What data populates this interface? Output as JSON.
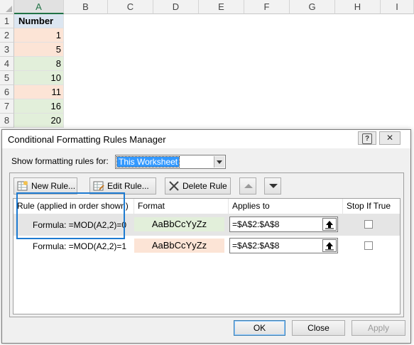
{
  "sheet": {
    "columns": [
      "A",
      "B",
      "C",
      "D",
      "E",
      "F",
      "G",
      "H",
      "I"
    ],
    "rows": [
      "1",
      "2",
      "3",
      "4",
      "5",
      "6",
      "7",
      "8"
    ],
    "header_cell": "Number",
    "values": [
      "1",
      "5",
      "8",
      "10",
      "11",
      "16",
      "20"
    ],
    "even_fill": "#e2efda",
    "odd_fill": "#fce4d6"
  },
  "dialog": {
    "title": "Conditional Formatting Rules Manager",
    "help_label": "?",
    "close_label": "✕",
    "show_label": "Show formatting rules for:",
    "scope_value": "This Worksheet",
    "buttons": {
      "new_rule": "New Rule...",
      "edit_rule": "Edit Rule...",
      "delete_rule": "Delete Rule"
    },
    "columns": {
      "rule": "Rule (applied in order shown)",
      "format": "Format",
      "applies_to": "Applies to",
      "stop_if_true": "Stop If True"
    },
    "rules": [
      {
        "rule": "Formula: =MOD(A2,2)=0",
        "format_preview": "AaBbCcYyZz",
        "fill": "#e2efda",
        "applies_to": "=$A$2:$A$8",
        "stop_if_true": false
      },
      {
        "rule": "Formula: =MOD(A2,2)=1",
        "format_preview": "AaBbCcYyZz",
        "fill": "#fce4d6",
        "applies_to": "=$A$2:$A$8",
        "stop_if_true": false
      }
    ],
    "footer": {
      "ok": "OK",
      "close": "Close",
      "apply": "Apply"
    },
    "highlight_color": "#1e7bd1"
  }
}
